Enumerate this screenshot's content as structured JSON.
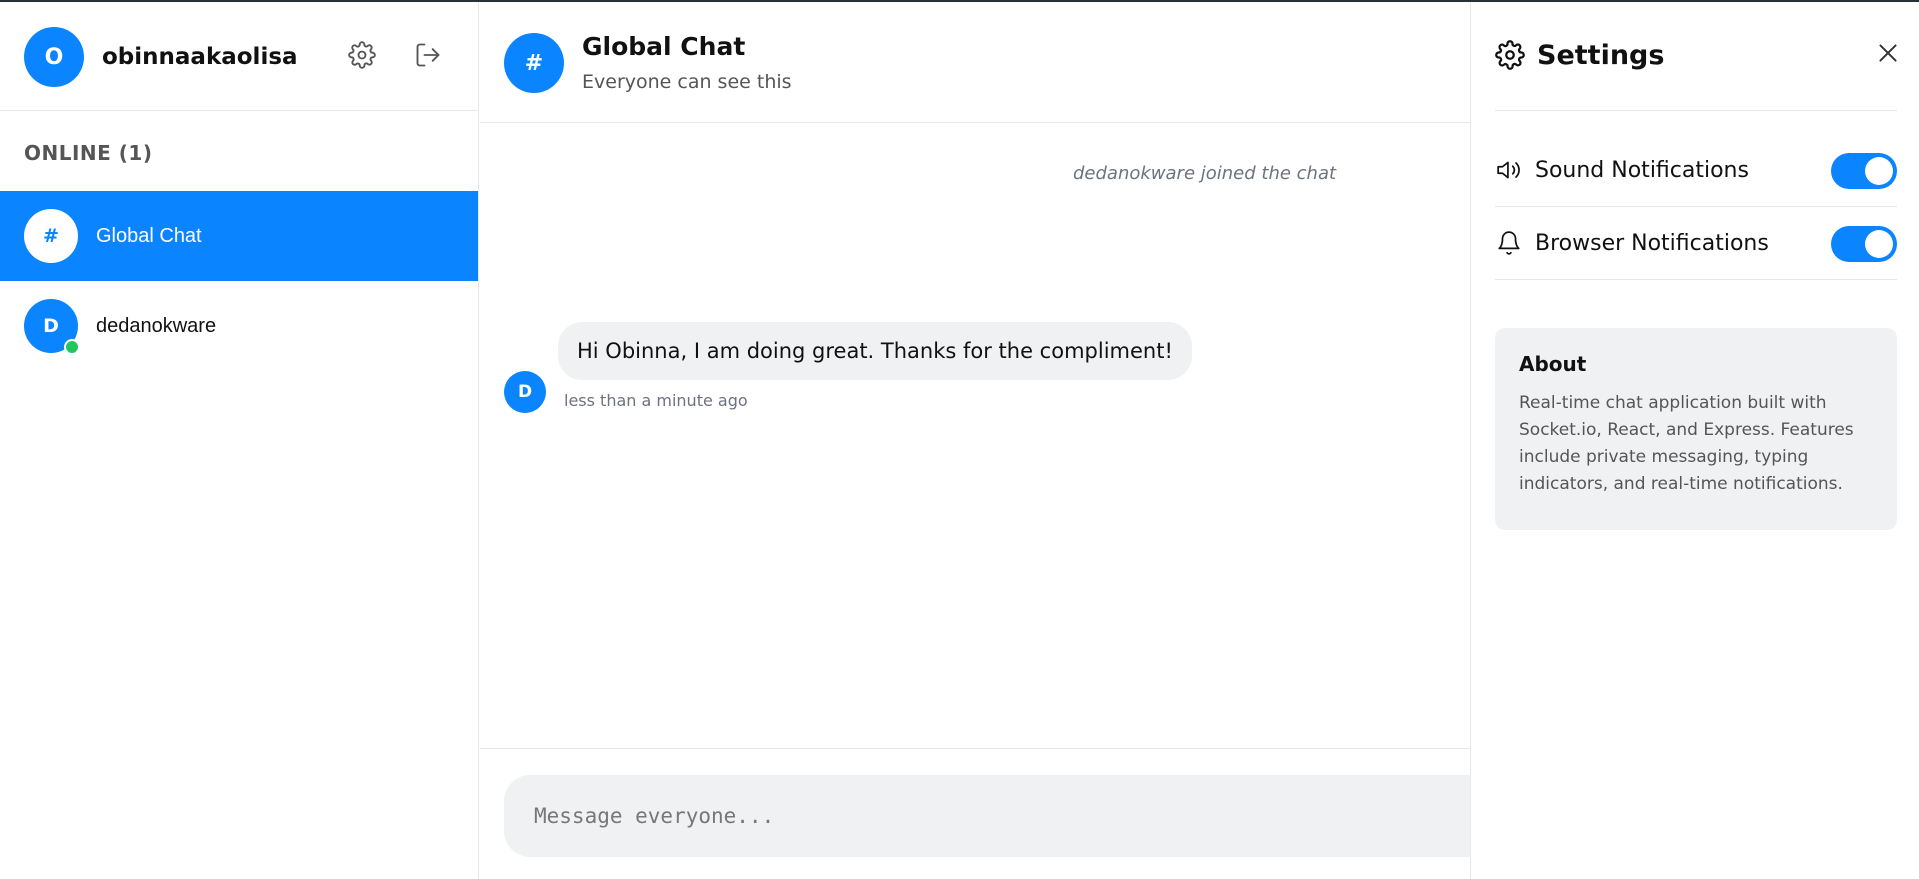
{
  "user": {
    "name": "obinnaakaolisa",
    "avatar_initial": "O",
    "settings_icon": "gear-icon",
    "logout_icon": "logout-icon"
  },
  "sidebar": {
    "online_title": "ONLINE (1)",
    "rooms": [
      {
        "label": "Global Chat",
        "avatar": "#",
        "active": true
      },
      {
        "label": "dedanokware",
        "avatar": "D",
        "online": true
      }
    ]
  },
  "chat": {
    "title": "Global Chat",
    "subtitle": "Everyone can see this",
    "avatar": "#",
    "system_message": "dedanokware joined the chat",
    "messages": [
      {
        "avatar": "D",
        "text": "Hi Obinna, I am doing great. Thanks for the compliment!",
        "time": "less than a minute ago"
      }
    ],
    "input_placeholder": "Message everyone..."
  },
  "settings": {
    "title": "Settings",
    "sound_label": "Sound Notifications",
    "sound_enabled": true,
    "browser_label": "Browser Notifications",
    "browser_enabled": true,
    "about_title": "About",
    "about_text": "Real-time chat application built with Socket.io, React, and Express. Features include private messaging, typing indicators, and real-time notifications."
  },
  "colors": {
    "accent": "#0a84ff",
    "online": "#22c55e",
    "bubble": "#f0f1f3"
  }
}
